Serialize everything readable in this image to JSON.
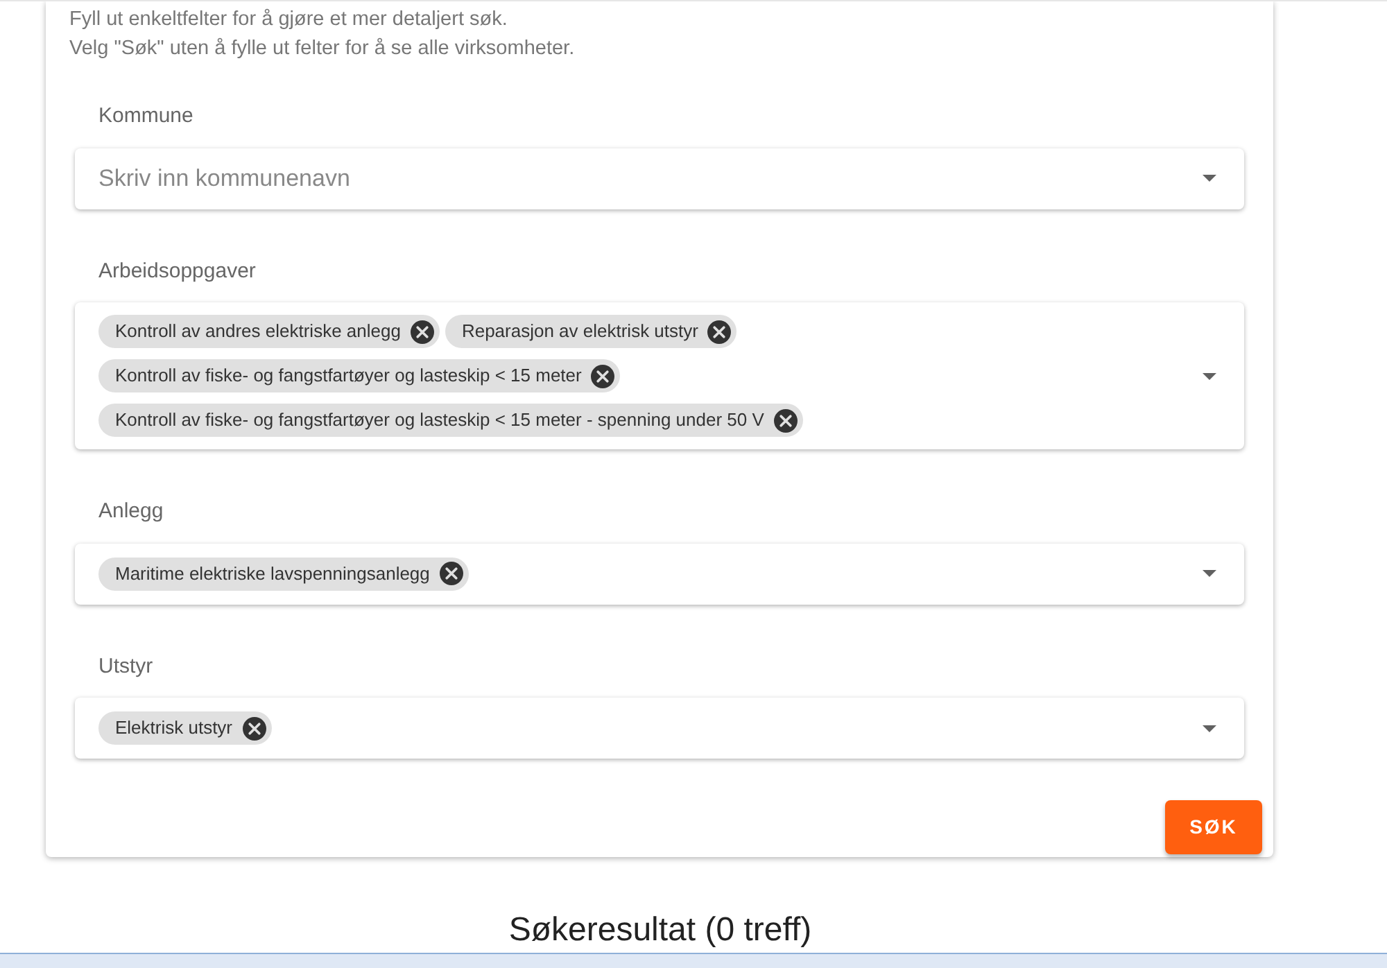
{
  "intro": [
    "Fyll ut enkeltfelter for å gjøre et mer detaljert søk.",
    "Velg \"Søk\" uten å fylle ut felter for å se alle virksomheter."
  ],
  "fields": [
    {
      "label": "Kommune",
      "placeholder": "Skriv inn kommunenavn"
    },
    {
      "label": "Arbeidsoppgaver",
      "chips": [
        "Kontroll av andres elektriske anlegg",
        "Reparasjon av elektrisk utstyr",
        "Kontroll av fiske- og fangstfartøyer og lasteskip < 15 meter",
        "Kontroll av fiske- og fangstfartøyer og lasteskip < 15 meter - spenning under 50 V"
      ]
    },
    {
      "label": "Anlegg",
      "chips": [
        "Maritime elektriske lavspenningsanlegg"
      ]
    },
    {
      "label": "Utstyr",
      "chips": [
        "Elektrisk utstyr"
      ]
    }
  ],
  "search_button": "SØK",
  "results_title": "Søkeresultat (0 treff)"
}
